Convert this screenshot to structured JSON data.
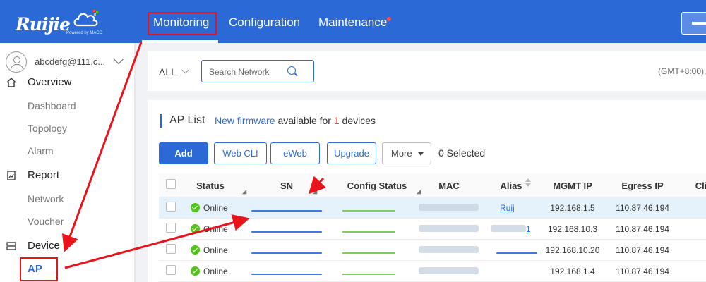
{
  "brand": {
    "name": "Ruijie",
    "tagline": "Powered by MACC"
  },
  "nav": {
    "items": [
      {
        "label": "Monitoring",
        "active": true
      },
      {
        "label": "Configuration"
      },
      {
        "label": "Maintenance",
        "has_notification": true
      }
    ]
  },
  "account": {
    "name": "abcdefg@111.c..."
  },
  "sidebar": {
    "overview": {
      "label": "Overview",
      "icon": "home-icon",
      "items": [
        "Dashboard",
        "Topology",
        "Alarm"
      ]
    },
    "report": {
      "label": "Report",
      "icon": "report-icon",
      "items": [
        "Network",
        "Voucher"
      ]
    },
    "device": {
      "label": "Device",
      "icon": "device-icon",
      "items": [
        "AP"
      ],
      "active": "AP"
    }
  },
  "filter": {
    "scope": "ALL",
    "search_placeholder": "Search Network",
    "timezone": "(GMT+8:00),"
  },
  "ap_list": {
    "title": "AP List",
    "notice_link": "New firmware",
    "notice_mid": " available for ",
    "notice_count": "1",
    "notice_end": " devices",
    "buttons": {
      "add": "Add",
      "webcli": "Web CLI",
      "eweb": "eWeb",
      "upgrade": "Upgrade",
      "more": "More"
    },
    "selected": "0 Selected",
    "columns": [
      "Status",
      "SN",
      "Config Status",
      "MAC",
      "Alias",
      "MGMT IP",
      "Egress IP",
      "Cli"
    ],
    "rows": [
      {
        "status": "Online",
        "alias": "Ruij",
        "mgmt_ip": "192.168.1.5",
        "egress_ip": "110.87.46.194"
      },
      {
        "status": "Online",
        "alias": "1",
        "mgmt_ip": "192.168.10.3",
        "egress_ip": "110.87.46.194"
      },
      {
        "status": "Online",
        "alias": "",
        "mgmt_ip": "192.168.10.20",
        "egress_ip": "110.87.46.194"
      },
      {
        "status": "Online",
        "alias": "",
        "mgmt_ip": "192.168.1.4",
        "egress_ip": "110.87.46.194"
      }
    ]
  },
  "colors": {
    "primary": "#2b6ad6",
    "annotation": "#e8131b",
    "online": "#52c41a"
  }
}
